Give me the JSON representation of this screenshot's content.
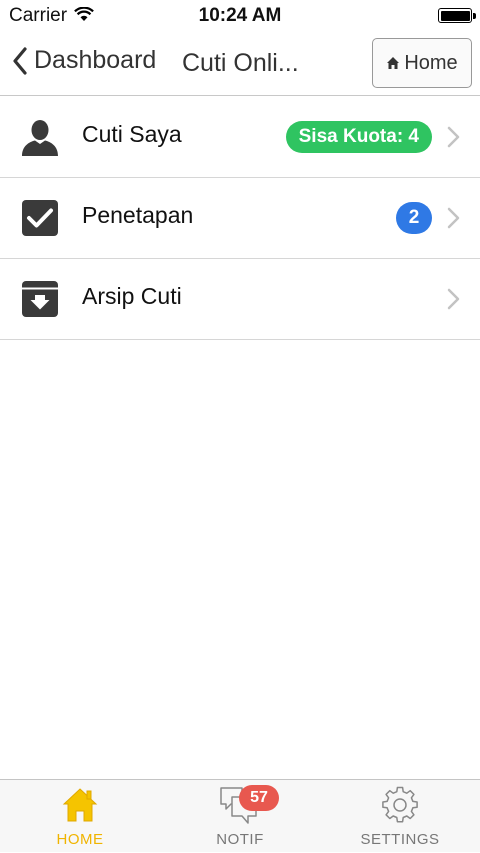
{
  "status_bar": {
    "carrier": "Carrier",
    "time": "10:24 AM"
  },
  "navbar": {
    "back_label": "Dashboard",
    "title": "Cuti Onli...",
    "home_button": "Home"
  },
  "menu": [
    {
      "icon": "person-icon",
      "label": "Cuti Saya",
      "badge": "Sisa Kuota: 4",
      "badge_color": "#2fc461"
    },
    {
      "icon": "checkbox-icon",
      "label": "Penetapan",
      "badge": "2",
      "badge_color": "#2f79e5"
    },
    {
      "icon": "archive-icon",
      "label": "Arsip Cuti"
    }
  ],
  "tabbar": {
    "tabs": [
      {
        "label": "HOME",
        "icon": "home-icon",
        "active": true
      },
      {
        "label": "NOTIF",
        "icon": "chat-icon",
        "badge": "57"
      },
      {
        "label": "SETTINGS",
        "icon": "gear-icon"
      }
    ]
  },
  "colors": {
    "active_tab": "#f0b400",
    "notif_badge": "#e8584f"
  }
}
